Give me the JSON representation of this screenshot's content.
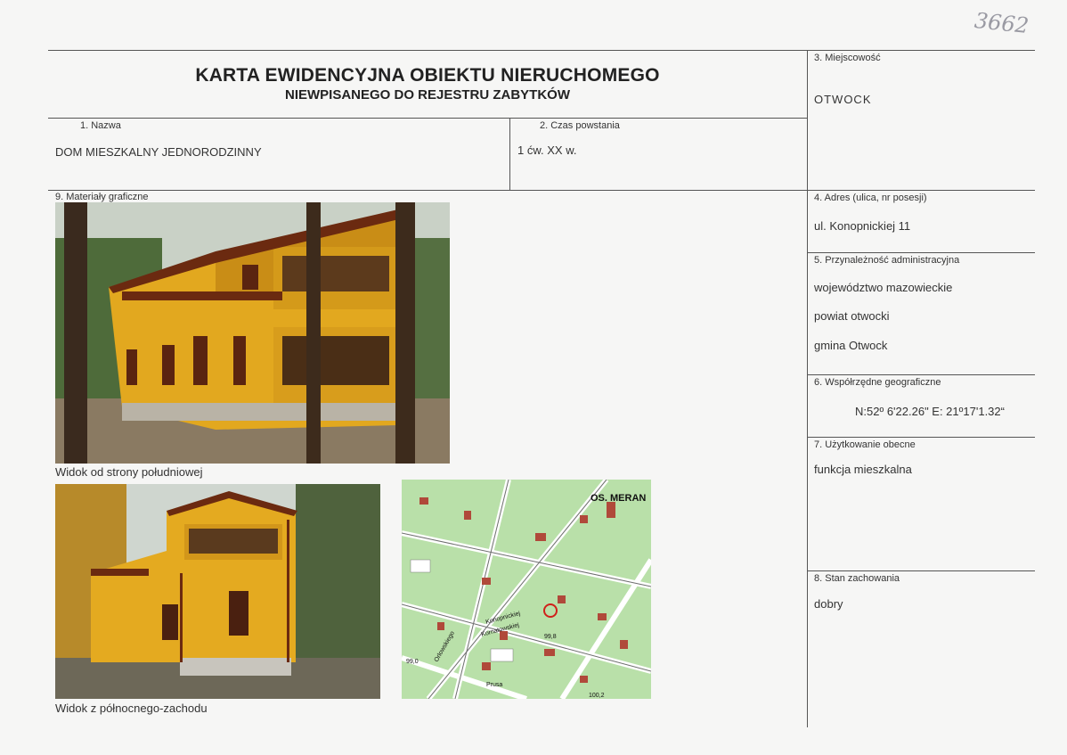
{
  "title": {
    "line1": "KARTA EWIDENCYJNA OBIEKTU NIERUCHOMEGO",
    "line2": "NIEWPISANEGO DO REJESTRU ZABYTKÓW"
  },
  "fields": {
    "name": {
      "label": "1.   Nazwa",
      "value": "DOM MIESZKALNY JEDNORODZINNY"
    },
    "date": {
      "label": "2.   Czas powstania",
      "value": "1 ćw. XX w."
    },
    "locality": {
      "label": "3. Miejscowość",
      "value": "OTWOCK"
    },
    "address": {
      "label": "4. Adres (ulica, nr posesji)",
      "value": "ul. Konopnickiej 11"
    },
    "admin": {
      "label": "5. Przynależność administracyjna",
      "voivodeship": "województwo mazowieckie",
      "county": "powiat otwocki",
      "commune": "gmina Otwock"
    },
    "coords": {
      "label": "6. Współrzędne geograficzne",
      "value": "N:52º 6'22.26\" E: 21º17'1.32“"
    },
    "usage": {
      "label": "7. Użytkowanie obecne",
      "value": "funkcja mieszkalna"
    },
    "condition": {
      "label": "8. Stan zachowania",
      "value": "dobry"
    },
    "graphics": {
      "label": "9. Materiały graficzne"
    }
  },
  "captions": {
    "photo_south": "Widok od strony południowej",
    "photo_northwest": "Widok z północnego-zachodu"
  },
  "map": {
    "labels": [
      "OS. MERAN",
      "Konopnickiej",
      "Kornatowskiej",
      "Prusa",
      "Orlowskiego",
      "99,8",
      "99,0",
      "100,2"
    ]
  },
  "handwritten_number": "3662",
  "colors": {
    "facade": "#e0a51c",
    "trim": "#6b2a10",
    "map_green": "#b9e0a9",
    "marker": "#d0201a"
  }
}
